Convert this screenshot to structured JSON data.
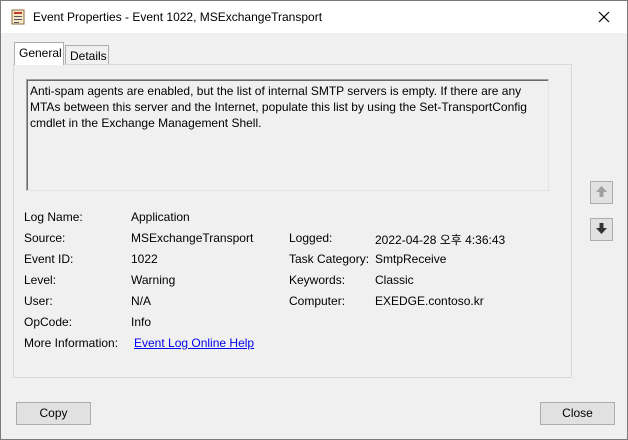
{
  "window": {
    "title": "Event Properties - Event 1022, MSExchangeTransport",
    "icon": "event-viewer-icon",
    "close_icon": "close-icon"
  },
  "tabs": [
    "General",
    "Details"
  ],
  "description": "Anti-spam agents are enabled, but the list of internal SMTP servers is empty. If there are any MTAs between this server and the Internet, populate this list by using the Set-TransportConfig cmdlet in the Exchange Management Shell.",
  "fields": {
    "log_name": {
      "label": "Log Name:",
      "value": "Application"
    },
    "source": {
      "label": "Source:",
      "value": "MSExchangeTransport"
    },
    "logged": {
      "label": "Logged:",
      "value": "2022-04-28 오후 4:36:43"
    },
    "event_id": {
      "label": "Event ID:",
      "value": "1022"
    },
    "task_category": {
      "label": "Task Category:",
      "value": "SmtpReceive"
    },
    "level": {
      "label": "Level:",
      "value": "Warning"
    },
    "keywords": {
      "label": "Keywords:",
      "value": "Classic"
    },
    "user": {
      "label": "User:",
      "value": "N/A"
    },
    "computer": {
      "label": "Computer:",
      "value": "EXEDGE.contoso.kr"
    },
    "opcode": {
      "label": "OpCode:",
      "value": "Info"
    },
    "more_info": {
      "label": "More Information:",
      "link": "Event Log Online Help"
    }
  },
  "side_buttons": {
    "up_icon": "arrow-up-icon",
    "down_icon": "arrow-down-icon"
  },
  "buttons": {
    "copy": "Copy",
    "close": "Close"
  }
}
